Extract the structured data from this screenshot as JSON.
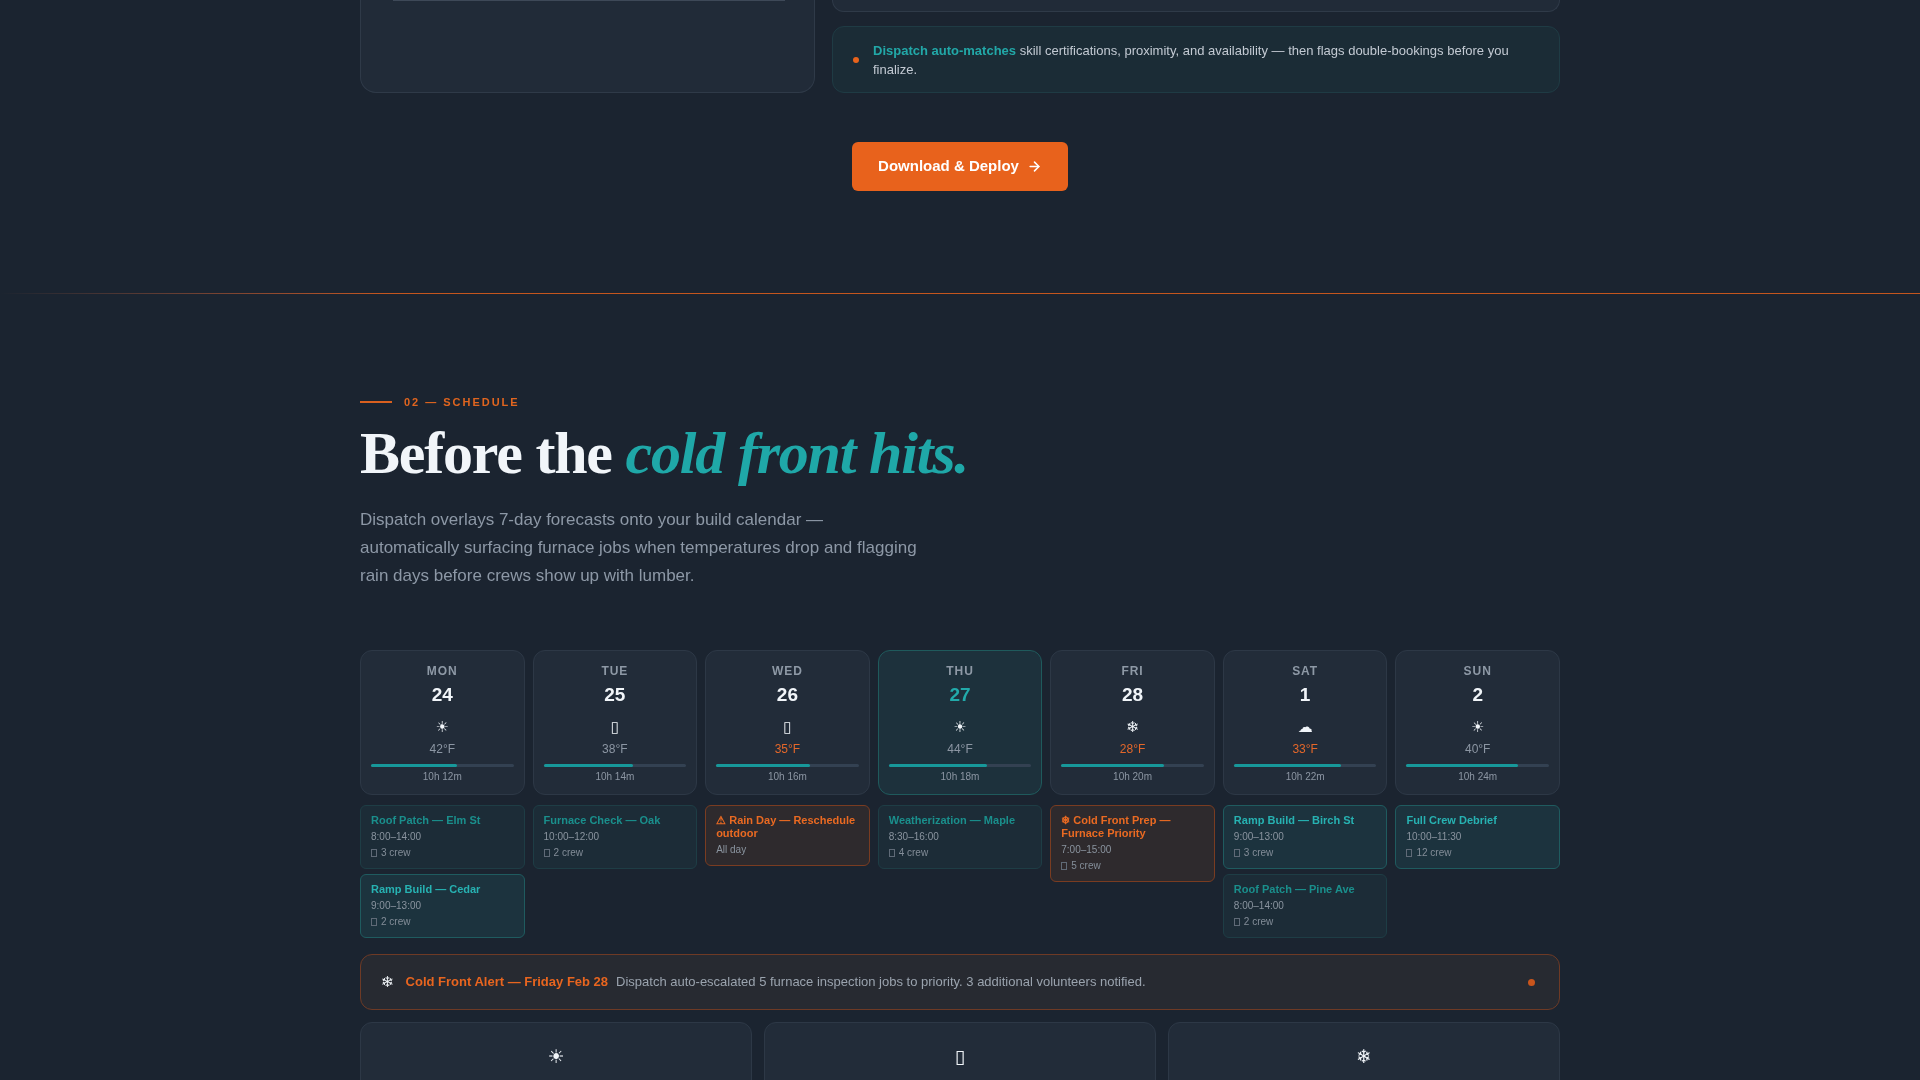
{
  "previous_section": {
    "notice": {
      "text": "**Dispatch auto-matches** skill certifications, proximity, and availability — then flags double-bookings before you finalize."
    },
    "cta_button": {
      "label": "Download & Deploy"
    }
  },
  "schedule": {
    "eyebrow": "02 — SCHEDULE",
    "heading": "Before the *cold front hits.*",
    "description": "Dispatch overlays 7-day forecasts onto your build calendar — automatically surfacing furnace jobs when temperatures drop and flagging rain days before crews show up with lumber.",
    "days": [
      {
        "weekday": "MON",
        "date": "24",
        "icon": "☀",
        "temperature": "42°F",
        "cold": false,
        "today": false,
        "daylight": {
          "level": 0.6,
          "reading": "10h 12m"
        },
        "jobs": [
          {
            "kind": "muted",
            "title": "Roof Patch — Elm St",
            "time": "8:00–14:00",
            "crew": "3 crew"
          },
          {
            "kind": "accent",
            "title": "Ramp Build — Cedar",
            "time": "9:00–13:00",
            "crew": "2 crew"
          }
        ]
      },
      {
        "weekday": "TUE",
        "date": "25",
        "icon": "▯",
        "temperature": "38°F",
        "cold": false,
        "today": false,
        "daylight": {
          "level": 0.63,
          "reading": "10h 14m"
        },
        "jobs": [
          {
            "kind": "muted",
            "title": "Furnace Check — Oak",
            "time": "10:00–12:00",
            "crew": "2 crew"
          }
        ]
      },
      {
        "weekday": "WED",
        "date": "26",
        "icon": "▯",
        "temperature": "35°F",
        "cold": true,
        "today": false,
        "daylight": {
          "level": 0.66,
          "reading": "10h 16m"
        },
        "jobs": [
          {
            "kind": "alert",
            "title": "⚠ Rain Day — Reschedule outdoor",
            "time": "All day"
          }
        ]
      },
      {
        "weekday": "THU",
        "date": "27",
        "icon": "☀",
        "temperature": "44°F",
        "cold": false,
        "today": true,
        "daylight": {
          "level": 0.69,
          "reading": "10h 18m"
        },
        "jobs": [
          {
            "kind": "muted",
            "title": "Weatherization — Maple",
            "time": "8:30–16:00",
            "crew": "4 crew"
          }
        ]
      },
      {
        "weekday": "FRI",
        "date": "28",
        "icon": "❄",
        "temperature": "28°F",
        "cold": true,
        "today": false,
        "daylight": {
          "level": 0.72,
          "reading": "10h 20m"
        },
        "jobs": [
          {
            "kind": "alert",
            "title": "❄ Cold Front Prep — Furnace Priority",
            "time": "7:00–15:00",
            "crew": "5 crew"
          }
        ]
      },
      {
        "weekday": "SAT",
        "date": "1",
        "icon": "☁",
        "temperature": "33°F",
        "cold": true,
        "today": false,
        "daylight": {
          "level": 0.75,
          "reading": "10h 22m"
        },
        "jobs": [
          {
            "kind": "accent",
            "title": "Ramp Build — Birch St",
            "time": "9:00–13:00",
            "crew": "3 crew"
          },
          {
            "kind": "muted",
            "title": "Roof Patch — Pine Ave",
            "time": "8:00–14:00",
            "crew": "2 crew"
          }
        ]
      },
      {
        "weekday": "SUN",
        "date": "2",
        "icon": "☀",
        "temperature": "40°F",
        "cold": false,
        "today": false,
        "daylight": {
          "level": 0.78,
          "reading": "10h 24m"
        },
        "jobs": [
          {
            "kind": "accent",
            "title": "Full Crew Debrief",
            "time": "10:00–11:30",
            "crew": "12 crew"
          }
        ]
      }
    ],
    "alert": {
      "icon": "❄",
      "title": "Cold Front Alert — Friday Feb 28",
      "message": "Dispatch auto-escalated 5 furnace inspection jobs to priority. 3 additional volunteers notified."
    },
    "feature_cards": [
      {
        "icon": "☀"
      },
      {
        "icon": "▯"
      },
      {
        "icon": "❄"
      }
    ]
  }
}
